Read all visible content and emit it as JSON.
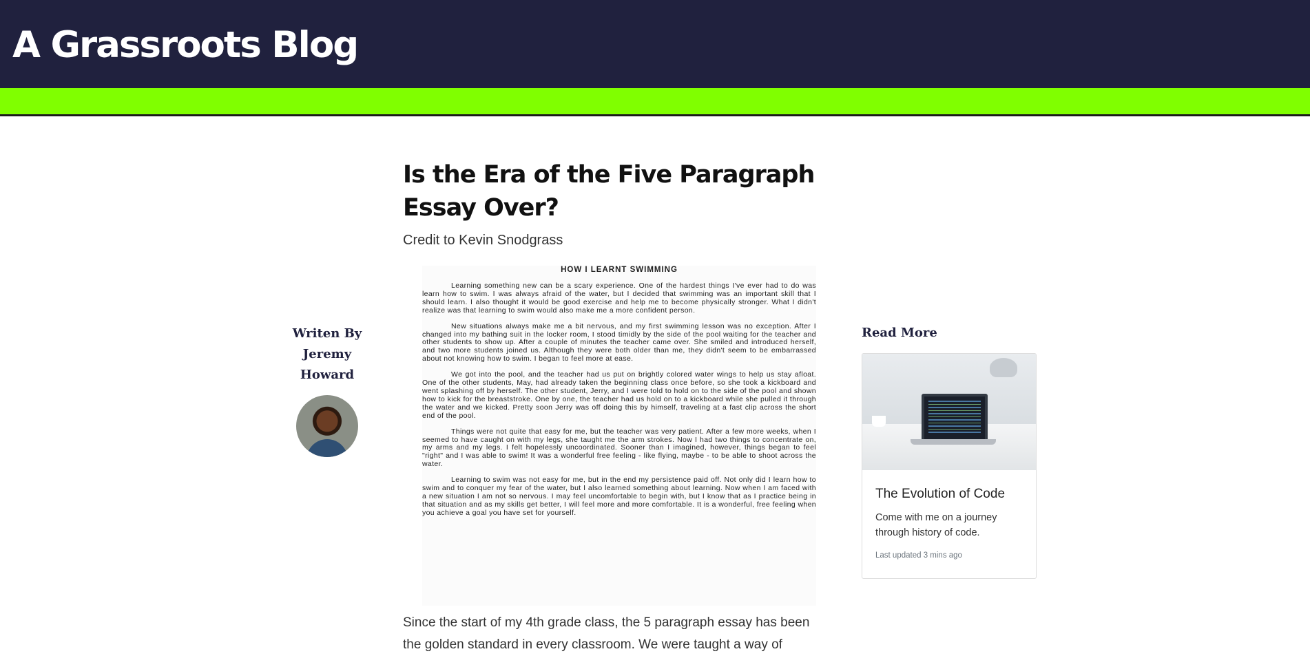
{
  "header": {
    "site_title": "A Grassroots Blog"
  },
  "author": {
    "written_by": "Writen By",
    "name": "Jeremy Howard"
  },
  "article": {
    "title": "Is the Era of the Five Paragraph Essay Over?",
    "credit": "Credit to Kevin Snodgrass",
    "essay_image": {
      "heading": "HOW I LEARNT SWIMMING",
      "paragraphs": [
        "Learning something new can be a scary experience. One of the hardest things I've ever had to do was learn how to swim. I was always afraid of the water, but I decided that swimming was an important skill that I should learn. I also thought it would be good exercise and help me to become physically stronger. What I didn't realize was that learning to swim would also make me a more confident person.",
        "New situations always make me a bit nervous, and my first swimming lesson was no exception. After I changed into my bathing suit in the locker room, I stood timidly by the side of the pool waiting for the teacher and other students to show up. After a couple of minutes the teacher came over. She smiled and introduced herself, and two more students joined us. Although they were both older than me, they didn't seem to be embarrassed about not knowing how to swim. I began to feel more at ease.",
        "We got into the pool, and the teacher had us put on brightly colored water wings to help us stay afloat. One of the other students, May, had already taken the beginning class once before, so she took a kickboard and went splashing off by herself. The other student, Jerry, and I were told to hold on to the side of the pool and shown how to kick for the breaststroke. One by one, the teacher had us hold on to a kickboard while she pulled it through the water and we kicked. Pretty soon Jerry was off doing this by himself, traveling at a fast clip across the short end of the pool.",
        "Things were not quite that easy for me, but the teacher was very patient. After a few more weeks, when I seemed to have caught on with my legs, she taught me the arm strokes. Now I had two things to concentrate on, my arms and my legs. I felt hopelessly uncoordinated. Sooner than I imagined, however, things began to feel \"right\" and I was able to swim! It was a wonderful free feeling - like flying, maybe - to be able to shoot across the water.",
        "Learning to swim was not easy for me, but in the end my persistence paid off. Not only did I learn how to swim and to conquer my fear of the water, but I also learned something about learning. Now when I am faced with a new situation I am not so nervous. I may feel uncomfortable to begin with, but I know that as I practice being in that situation and as my skills get better, I will feel more and more comfortable. It is a wonderful, free feeling when you achieve a goal you have set for yourself."
      ]
    },
    "body": "Since the start of my 4th grade class, the 5 paragraph essay has been the golden standard in every classroom. We were taught a way of"
  },
  "sidebar": {
    "read_more": "Read More",
    "card": {
      "image_icon": "laptop-desk-photo",
      "title": "The Evolution of Code",
      "text": "Come with me on a journey through history of code.",
      "meta": "Last updated 3 mins ago"
    }
  },
  "colors": {
    "header_bg": "#20213e",
    "accent": "#80ff00"
  }
}
